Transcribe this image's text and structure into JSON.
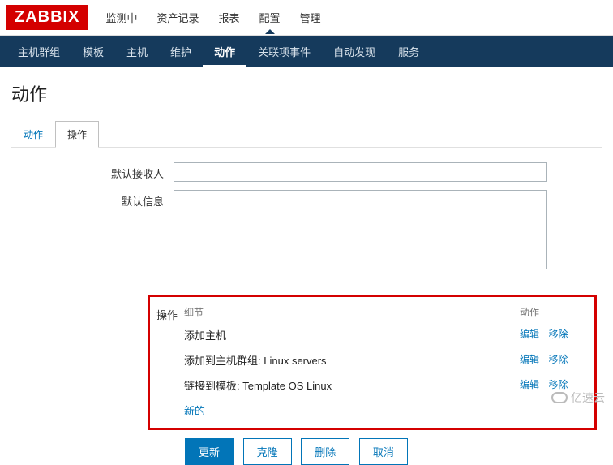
{
  "logo": "ZABBIX",
  "topnav": {
    "items": [
      {
        "label": "监测中"
      },
      {
        "label": "资产记录"
      },
      {
        "label": "报表"
      },
      {
        "label": "配置",
        "active": true
      },
      {
        "label": "管理"
      }
    ]
  },
  "subnav": {
    "items": [
      {
        "label": "主机群组"
      },
      {
        "label": "模板"
      },
      {
        "label": "主机"
      },
      {
        "label": "维护"
      },
      {
        "label": "动作",
        "active": true
      },
      {
        "label": "关联项事件"
      },
      {
        "label": "自动发现"
      },
      {
        "label": "服务"
      }
    ]
  },
  "page_title": "动作",
  "tabs": [
    {
      "label": "动作"
    },
    {
      "label": "操作",
      "active": true
    }
  ],
  "form": {
    "recipient_label": "默认接收人",
    "recipient_value": "",
    "message_label": "默认信息",
    "message_value": ""
  },
  "operations": {
    "section_label": "操作",
    "col_detail": "细节",
    "col_action": "动作",
    "rows": [
      {
        "detail": "添加主机"
      },
      {
        "detail_prefix": "添加到主机群组:",
        "detail_value": "Linux servers"
      },
      {
        "detail_prefix": "链接到模板:",
        "detail_value": "Template OS Linux"
      }
    ],
    "edit_label": "编辑",
    "remove_label": "移除",
    "new_label": "新的"
  },
  "buttons": {
    "update": "更新",
    "clone": "克隆",
    "delete": "删除",
    "cancel": "取消"
  },
  "watermark": "亿速云"
}
